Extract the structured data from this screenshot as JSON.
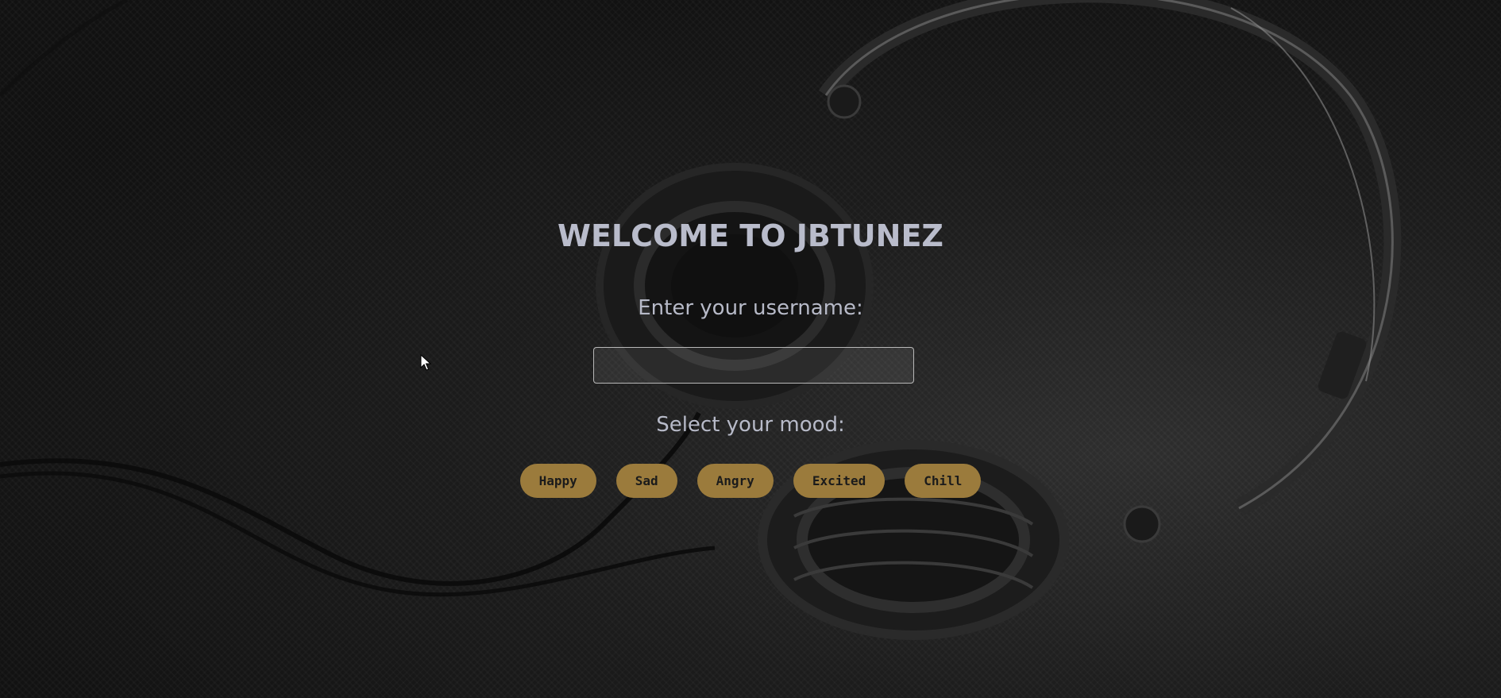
{
  "page": {
    "title": "WELCOME TO JBTUNEZ",
    "username_label": "Enter your username:",
    "mood_label": "Select your mood:"
  },
  "username_input": {
    "value": "",
    "placeholder": ""
  },
  "moods": [
    {
      "label": "Happy"
    },
    {
      "label": "Sad"
    },
    {
      "label": "Angry"
    },
    {
      "label": "Excited"
    },
    {
      "label": "Chill"
    }
  ],
  "colors": {
    "background": "#141414",
    "title_text": "#b9bccb",
    "button_bg": "#9b7b3c",
    "button_text": "#1b1b1b"
  },
  "background_image": "headphones-photo"
}
